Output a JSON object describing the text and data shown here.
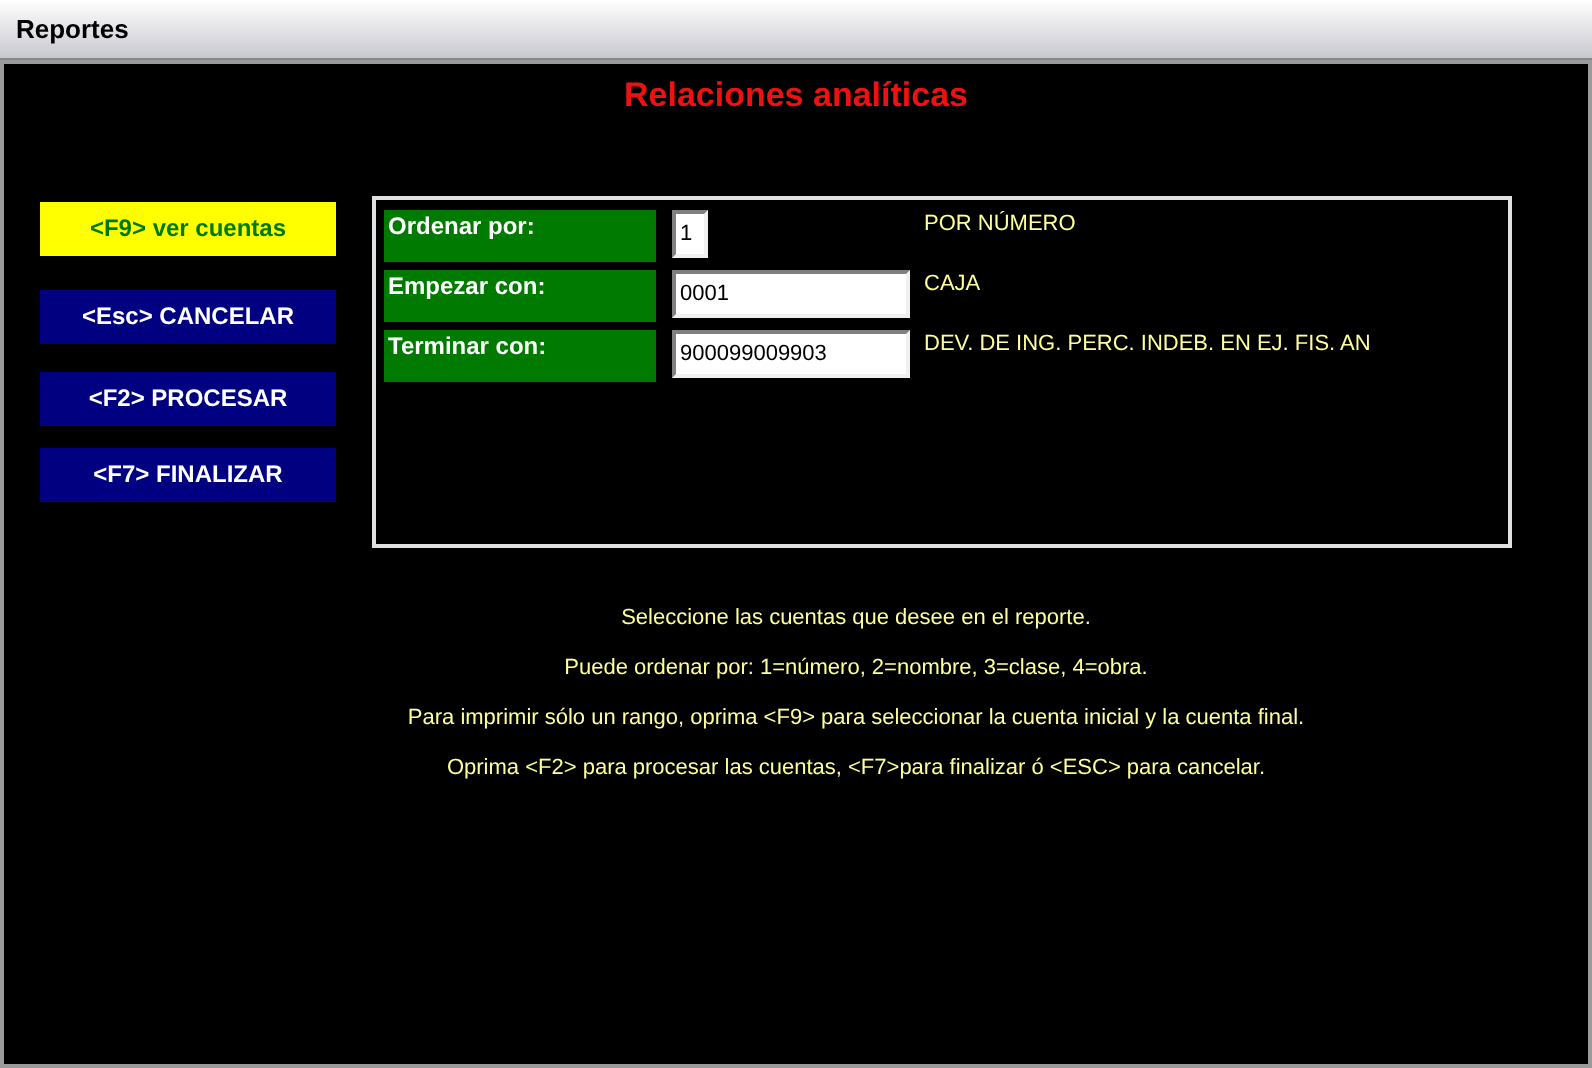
{
  "window": {
    "title": "Reportes"
  },
  "heading": "Relaciones analíticas",
  "buttons": [
    {
      "label": "<F9> ver cuentas",
      "selected": true
    },
    {
      "label": "<Esc> CANCELAR",
      "selected": false
    },
    {
      "label": "<F2> PROCESAR",
      "selected": false
    },
    {
      "label": "<F7> FINALIZAR",
      "selected": false
    }
  ],
  "fields": [
    {
      "label": "Ordenar por:",
      "value": "1",
      "kind": "short",
      "description": "POR NÚMERO"
    },
    {
      "label": "Empezar con:",
      "value": "0001",
      "kind": "long",
      "description": "CAJA"
    },
    {
      "label": "Terminar con:",
      "value": "900099009903",
      "kind": "long",
      "description": "DEV. DE ING. PERC. INDEB. EN EJ. FIS. AN"
    }
  ],
  "instructions": [
    "Seleccione las cuentas que desee en el reporte.",
    "Puede ordenar por: 1=número, 2=nombre, 3=clase, 4=obra.",
    "Para imprimir sólo un rango, oprima <F9> para seleccionar la cuenta inicial y la cuenta final.",
    "Oprima <F2> para procesar las cuentas, <F7>para finalizar ó <ESC> para cancelar."
  ]
}
